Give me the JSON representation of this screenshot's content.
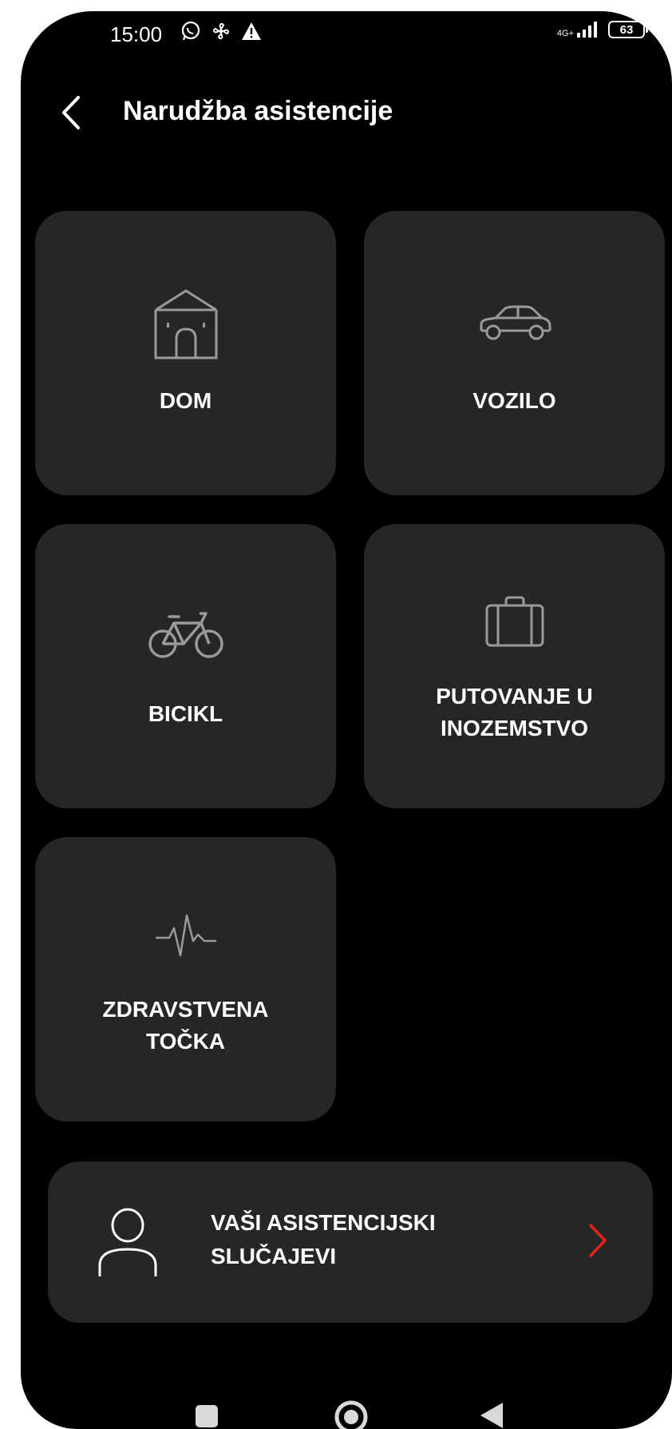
{
  "status_bar": {
    "time": "15:00",
    "network_type": "4G+",
    "battery_level": "63",
    "icons": [
      "whatsapp-icon",
      "fan-icon",
      "warning-icon",
      "signal-icon",
      "battery-icon"
    ]
  },
  "header": {
    "title": "Narudžba asistencije",
    "back_icon": "chevron-left-icon"
  },
  "categories": [
    {
      "label": "DOM",
      "icon": "house-icon"
    },
    {
      "label": "VOZILO",
      "icon": "car-icon"
    },
    {
      "label": "BICIKL",
      "icon": "bicycle-icon"
    },
    {
      "label": "PUTOVANJE U\nINOZEMSTVO",
      "icon": "suitcase-icon"
    },
    {
      "label": "ZDRAVSTVENA\nTOČKA",
      "icon": "heartbeat-icon"
    }
  ],
  "cases_banner": {
    "label": "VAŠI ASISTENCIJSKI\nSLUČAJEVI",
    "icon": "user-icon",
    "arrow_icon": "chevron-right-icon"
  },
  "nav_bar": {
    "items": [
      "recents-button",
      "home-button",
      "back-button"
    ]
  },
  "colors": {
    "background": "#000000",
    "tile": "#262626",
    "icon_gray": "#9a9a9a",
    "accent_red": "#e2231a",
    "text": "#ffffff"
  }
}
